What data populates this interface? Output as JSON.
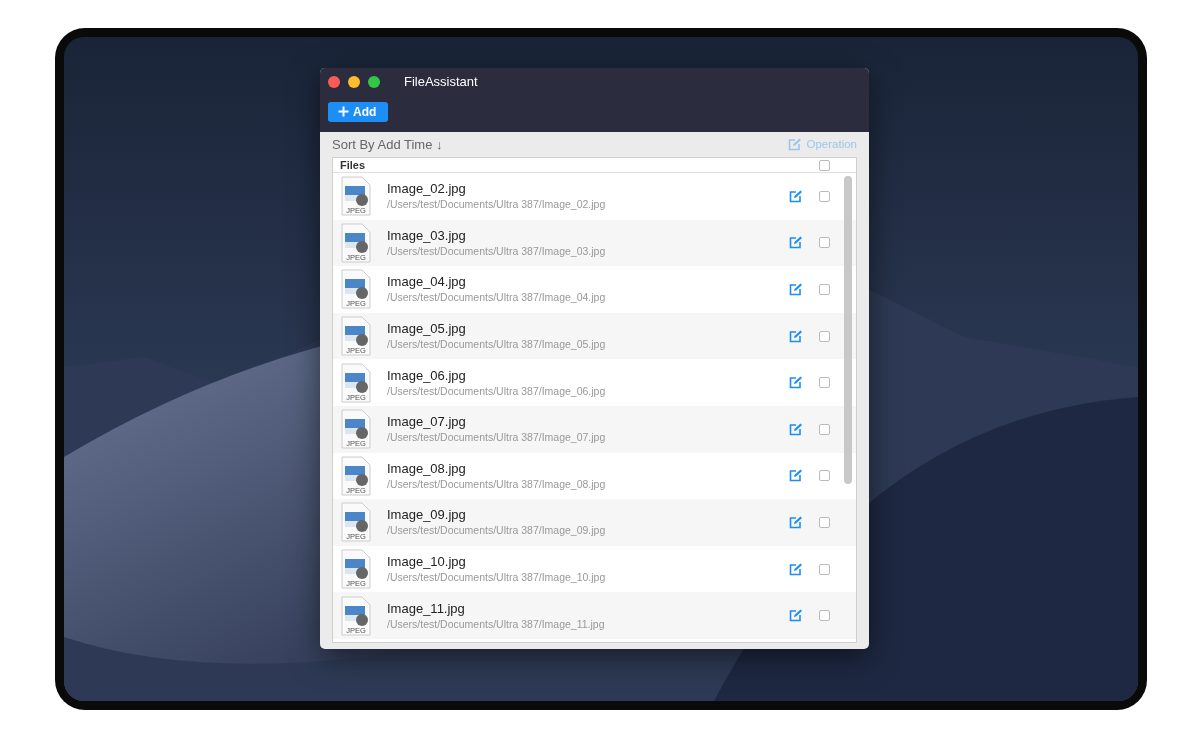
{
  "window": {
    "title": "FileAssistant"
  },
  "toolbar": {
    "add_button": "Add"
  },
  "sort_bar": {
    "sort_label": "Sort By Add Time ↓",
    "operation": "Operation",
    "operation_disabled": true
  },
  "list": {
    "header": "Files",
    "header_checked": false,
    "rows": [
      {
        "name": "Image_02.jpg",
        "path": "/Users/test/Documents/Ultra 387/Image_02.jpg",
        "icon_label": "JPEG",
        "checked": false
      },
      {
        "name": "Image_03.jpg",
        "path": "/Users/test/Documents/Ultra 387/Image_03.jpg",
        "icon_label": "JPEG",
        "checked": false
      },
      {
        "name": "Image_04.jpg",
        "path": "/Users/test/Documents/Ultra 387/Image_04.jpg",
        "icon_label": "JPEG",
        "checked": false
      },
      {
        "name": "Image_05.jpg",
        "path": "/Users/test/Documents/Ultra 387/Image_05.jpg",
        "icon_label": "JPEG",
        "checked": false
      },
      {
        "name": "Image_06.jpg",
        "path": "/Users/test/Documents/Ultra 387/Image_06.jpg",
        "icon_label": "JPEG",
        "checked": false
      },
      {
        "name": "Image_07.jpg",
        "path": "/Users/test/Documents/Ultra 387/Image_07.jpg",
        "icon_label": "JPEG",
        "checked": false
      },
      {
        "name": "Image_08.jpg",
        "path": "/Users/test/Documents/Ultra 387/Image_08.jpg",
        "icon_label": "JPEG",
        "checked": false
      },
      {
        "name": "Image_09.jpg",
        "path": "/Users/test/Documents/Ultra 387/Image_09.jpg",
        "icon_label": "JPEG",
        "checked": false
      },
      {
        "name": "Image_10.jpg",
        "path": "/Users/test/Documents/Ultra 387/Image_10.jpg",
        "icon_label": "JPEG",
        "checked": false
      },
      {
        "name": "Image_11.jpg",
        "path": "/Users/test/Documents/Ultra 387/Image_11.jpg",
        "icon_label": "JPEG",
        "checked": false
      }
    ]
  }
}
